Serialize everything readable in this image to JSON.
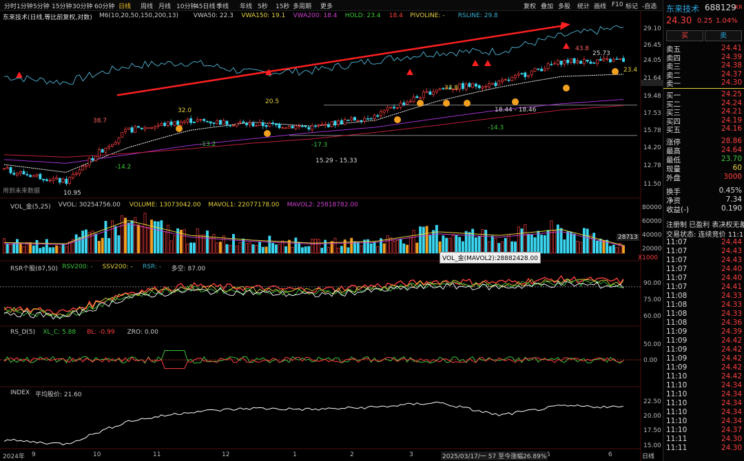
{
  "toolbar": {
    "periods": [
      "分时",
      "1分钟",
      "5分钟",
      "15分钟",
      "30分钟",
      "60分钟",
      "日线",
      "周线",
      "月线",
      "10分钟",
      "45日线",
      "季线",
      "年线",
      "5秒",
      "15秒",
      "多周期",
      "更多"
    ],
    "active_period": "日线",
    "tools": [
      "复权",
      "叠加",
      "多股",
      "统计",
      "画线",
      "F10",
      "标记",
      "-自选",
      "返回"
    ]
  },
  "main": {
    "title": "东来技术(日线,等比前复权,对数)",
    "indicators": [
      {
        "text": "M6(10,20,50,150,200,13)",
        "color": "#cfcfcf"
      },
      {
        "text": "VWA50: 22.3",
        "color": "#cfcfcf"
      },
      {
        "text": "VWA150: 19.1",
        "color": "#e8d33c"
      },
      {
        "text": "VWA200: 18.4",
        "color": "#d040d0"
      },
      {
        "text": "HOLD: 23.4",
        "color": "#3cc83c"
      },
      {
        "text": "18.4",
        "color": "#ff4040"
      },
      {
        "text": "PIVOLINE: -",
        "color": "#e8d33c"
      },
      {
        "text": "RSLINE: 29.8",
        "color": "#3ab0d0"
      }
    ],
    "note": "用到未来数据",
    "price_labels": [
      "38.7",
      "32.0",
      "20.5",
      "33.8",
      "43.8",
      "25.73",
      "23.4",
      "-14.2",
      "-13.2",
      "-17.3",
      "-14.3",
      "10.95",
      "18.44 - 18.46",
      "15.29 - 15.33"
    ],
    "axis_ticks": [
      "29.10",
      "26.45",
      "24.05",
      "21.64",
      "19.48",
      "17.53",
      "15.78",
      "14.20",
      "12.78",
      "11.50"
    ]
  },
  "vol_panel": {
    "items": [
      {
        "text": "VOL_金(5,25)",
        "color": "#cfcfcf"
      },
      {
        "text": "VVOL: 30254756.00",
        "color": "#cfcfcf"
      },
      {
        "text": "VOLUME: 13073042.00",
        "color": "#e8d33c"
      },
      {
        "text": "MAVOL1: 22077178.00",
        "color": "#e8d33c"
      },
      {
        "text": "MAVOL2: 25818782.00",
        "color": "#d040d0"
      }
    ],
    "axis_ticks": [
      "80000",
      "60000",
      "40000",
      "20000"
    ],
    "unit": "X1000",
    "current_marker": "28713",
    "tooltip": "VOL_金(MAVOL2):28882428.00"
  },
  "rsr_panel": {
    "items": [
      {
        "text": "RSR个股(87,50)",
        "color": "#cfcfcf"
      },
      {
        "text": "RSV200: -",
        "color": "#3cc83c"
      },
      {
        "text": "SSV200: -",
        "color": "#e8d33c"
      },
      {
        "text": "RSR: -",
        "color": "#3ab0d0"
      },
      {
        "text": "多空: 87.00",
        "color": "#cfcfcf"
      }
    ],
    "axis_ticks": [
      "90.00",
      "75.00",
      "60.00"
    ]
  },
  "rsd_panel": {
    "items": [
      {
        "text": "RS_D(5)",
        "color": "#cfcfcf"
      },
      {
        "text": "XL_C: 5.88",
        "color": "#3cc83c"
      },
      {
        "text": "BL: -0.99",
        "color": "#ff4040"
      },
      {
        "text": "ZRO: 0.00",
        "color": "#cfcfcf"
      }
    ],
    "axis_ticks": [
      "50.00",
      "0.00"
    ]
  },
  "index_panel": {
    "items": [
      {
        "text": "INDEX",
        "color": "#cfcfcf"
      },
      {
        "text": "平均股价: 21.60",
        "color": "#cfcfcf"
      }
    ],
    "axis_ticks": [
      "22.50",
      "20.00",
      "17.50",
      "15.00"
    ]
  },
  "xaxis": {
    "labels": [
      "2024年",
      "9",
      "10",
      "11",
      "12",
      "1",
      "2",
      "3",
      "4",
      "5",
      "6"
    ],
    "status_text": "2025/03/17/一 57 至今涨幅26.89%",
    "period_label": "日线"
  },
  "quote": {
    "name": "东来技术",
    "code": "688129",
    "code_suffix": "KR",
    "price": "24.30",
    "change": "0.25",
    "change_pct": "1.04%",
    "buy_label": "买",
    "sell_label": "卖",
    "asks": [
      {
        "label": "卖五",
        "price": "24.41"
      },
      {
        "label": "卖四",
        "price": "24.39"
      },
      {
        "label": "卖三",
        "price": "24.38"
      },
      {
        "label": "卖二",
        "price": "24.37"
      },
      {
        "label": "卖一",
        "price": "24.30"
      }
    ],
    "bids": [
      {
        "label": "买一",
        "price": "24.25"
      },
      {
        "label": "买二",
        "price": "24.24"
      },
      {
        "label": "买三",
        "price": "24.21"
      },
      {
        "label": "买四",
        "price": "24.19"
      },
      {
        "label": "买五",
        "price": "24.16"
      }
    ],
    "stats": [
      {
        "label": "涨停",
        "value": "28.86",
        "color": "#ff4040"
      },
      {
        "label": "最高",
        "value": "24.64",
        "color": "#ff4040"
      },
      {
        "label": "最低",
        "value": "23.70",
        "color": "#3cc83c"
      },
      {
        "label": "现量",
        "value": "60",
        "color": "#e8d33c"
      },
      {
        "label": "外盘",
        "value": "3000",
        "color": "#ff4040"
      }
    ],
    "stats2": [
      {
        "label": "换手",
        "value": "0.45%",
        "color": "#ddd"
      },
      {
        "label": "净资",
        "value": "7.34",
        "color": "#ddd"
      },
      {
        "label": "收益(-)",
        "value": "0.190",
        "color": "#ddd"
      }
    ],
    "reg_info": "注册制 已盈利 表决权无差",
    "trade_status": "交易状态: 连续竞价 11:11",
    "ticks": [
      {
        "time": "11:07",
        "price": "24.44"
      },
      {
        "time": "11:07",
        "price": "24.43"
      },
      {
        "time": "11:07",
        "price": "24.43"
      },
      {
        "time": "11:07",
        "price": "24.40"
      },
      {
        "time": "11:07",
        "price": "24.40"
      },
      {
        "time": "11:07",
        "price": "24.41"
      },
      {
        "time": "11:08",
        "price": "24.33"
      },
      {
        "time": "11:08",
        "price": "24.33"
      },
      {
        "time": "11:08",
        "price": "24.33"
      },
      {
        "time": "11:08",
        "price": "24.36"
      },
      {
        "time": "11:09",
        "price": "24.39"
      },
      {
        "time": "11:09",
        "price": "24.42"
      },
      {
        "time": "11:09",
        "price": "24.42"
      },
      {
        "time": "11:09",
        "price": "24.42"
      },
      {
        "time": "11:09",
        "price": "24.42"
      },
      {
        "time": "11:10",
        "price": "24.42"
      },
      {
        "time": "11:10",
        "price": "24.34"
      },
      {
        "time": "11:10",
        "price": "24.34"
      },
      {
        "time": "11:10",
        "price": "24.34"
      },
      {
        "time": "11:10",
        "price": "24.34"
      },
      {
        "time": "11:10",
        "price": "24.34"
      },
      {
        "time": "11:10",
        "price": "24.37"
      },
      {
        "time": "11:11",
        "price": "24.30"
      },
      {
        "time": "11:11",
        "price": "24.30"
      }
    ]
  },
  "colors": {
    "up": "#ff4040",
    "down": "#3ad6f0",
    "ma_white": "#ffffff",
    "ma_green": "#3cc83c",
    "ma_purple": "#a030d0",
    "ma_red": "#c0203a",
    "ma_cyan": "#4aa8c8"
  },
  "chart_data": {
    "type": "line",
    "title": "东来技术(日线,等比前复权,对数)",
    "x": [
      "2024-08",
      "2024-09",
      "2024-10",
      "2024-11",
      "2024-12",
      "2025-01",
      "2025-02",
      "2025-03",
      "2025-04",
      "2025-05",
      "2025-06"
    ],
    "series": [
      {
        "name": "Close",
        "values": [
          12.4,
          11.5,
          15.8,
          16.8,
          16.4,
          16.1,
          17.3,
          20.4,
          21.1,
          24.1,
          24.3
        ]
      },
      {
        "name": "VWA50",
        "values": [
          12.8,
          12.2,
          14.2,
          15.8,
          16.6,
          16.2,
          16.8,
          18.9,
          20.6,
          22.0,
          22.3
        ]
      },
      {
        "name": "VWA150",
        "values": [
          13.2,
          12.9,
          13.6,
          14.4,
          15.0,
          15.6,
          16.1,
          17.0,
          17.9,
          18.6,
          19.1
        ]
      },
      {
        "name": "VWA200",
        "values": [
          13.6,
          13.4,
          13.7,
          14.1,
          14.6,
          15.0,
          15.6,
          16.3,
          17.1,
          17.9,
          18.4
        ]
      },
      {
        "name": "RSLINE",
        "values": [
          22.0,
          21.2,
          23.5,
          24.0,
          22.5,
          22.8,
          24.3,
          25.5,
          25.7,
          28.2,
          29.8
        ]
      }
    ],
    "ylim": [
      11.0,
      31.0
    ],
    "log_scale": true,
    "volume_x1000": [
      18000,
      16000,
      55000,
      30000,
      22000,
      17000,
      20000,
      36000,
      30000,
      40000,
      13073
    ],
    "rsr": [
      68,
      64,
      82,
      88,
      86,
      84,
      88,
      92,
      91,
      94,
      92
    ],
    "index_avg_price": [
      16.0,
      15.3,
      19.2,
      20.8,
      21.4,
      21.2,
      21.6,
      22.4,
      20.2,
      21.8,
      21.6
    ]
  }
}
